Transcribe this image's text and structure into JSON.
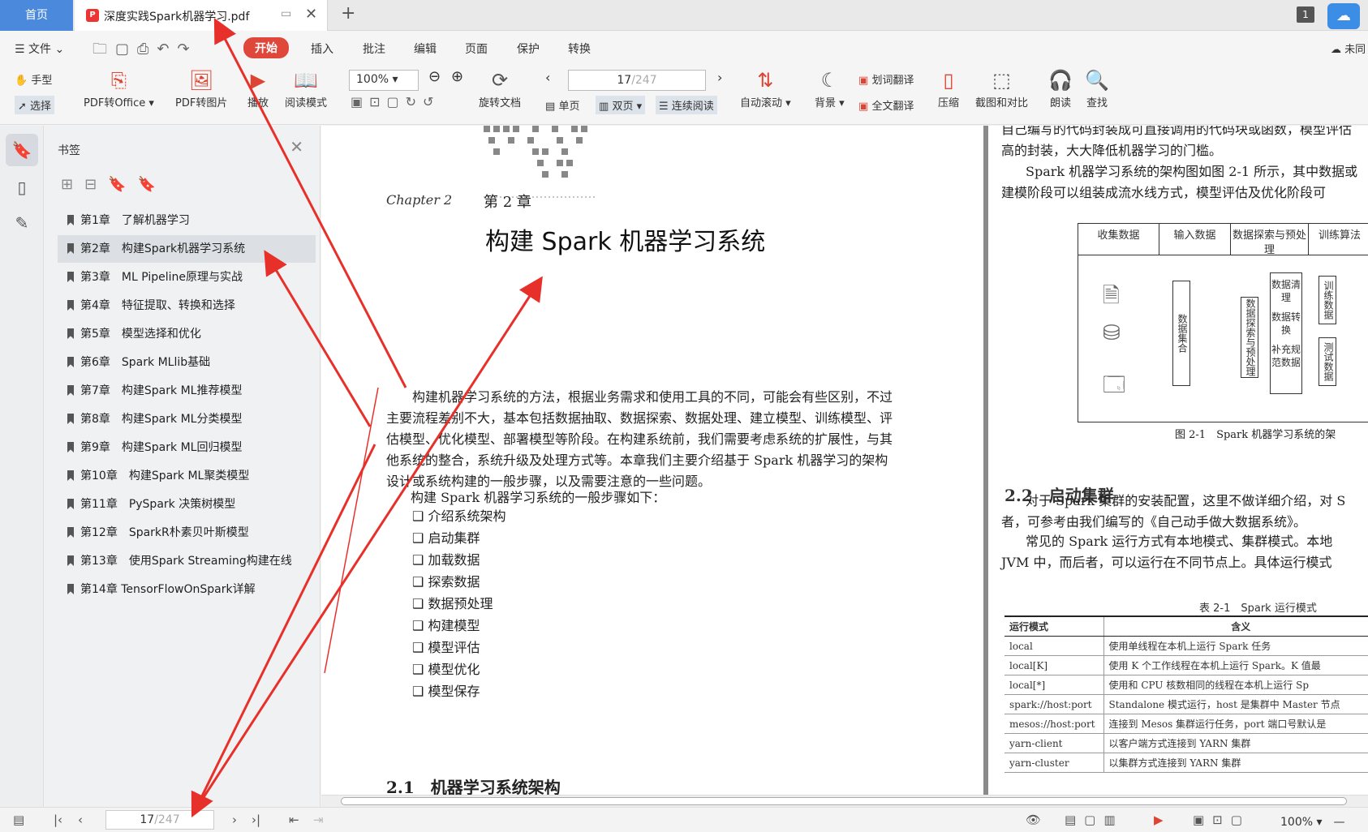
{
  "titlebar": {
    "home_tab": "首页",
    "doc_tab": "深度实践Spark机器学习.pdf",
    "badge": "1"
  },
  "menubar": {
    "file": "文件",
    "tabs": [
      "开始",
      "插入",
      "批注",
      "编辑",
      "页面",
      "保护",
      "转换"
    ],
    "active_tab": "开始",
    "cloud": "未同"
  },
  "ribbon": {
    "hand": "手型",
    "select": "选择",
    "pdf_to_office": "PDF转Office",
    "pdf_to_image": "PDF转图片",
    "play": "播放",
    "read_mode": "阅读模式",
    "zoom": "100%",
    "rotate": "旋转文档",
    "single": "单页",
    "double": "双页",
    "continuous": "连续阅读",
    "page_current": "17",
    "page_total": "/247",
    "auto_scroll": "自动滚动",
    "background": "背景",
    "word_translate": "划词翻译",
    "full_translate": "全文翻译",
    "compress": "压缩",
    "compare": "截图和对比",
    "read_aloud": "朗读",
    "search": "查找"
  },
  "panel": {
    "title": "书签",
    "bookmarks": [
      "第1章　了解机器学习",
      "第2章　构建Spark机器学习系统",
      "第3章　ML Pipeline原理与实战",
      "第4章　特征提取、转换和选择",
      "第5章　模型选择和优化",
      "第6章　Spark MLlib基础",
      "第7章　构建Spark ML推荐模型",
      "第8章　构建Spark ML分类模型",
      "第9章　构建Spark ML回归模型",
      "第10章　构建Spark ML聚类模型",
      "第11章　PySpark 决策树模型",
      "第12章　SparkR朴素贝叶斯模型",
      "第13章　使用Spark Streaming构建在线",
      "第14章 TensorFlowOnSpark详解"
    ],
    "selected_index": 1
  },
  "left_page": {
    "chapter_label": "Chapter 2",
    "chapter_no": "第 2 章",
    "chapter_title": "构建 Spark 机器学习系统",
    "paragraph": "构建机器学习系统的方法，根据业务需求和使用工具的不同，可能会有些区别，不过主要流程差别不大，基本包括数据抽取、数据探索、数据处理、建立模型、训练模型、评估模型、优化模型、部署模型等阶段。在构建系统前，我们需要考虑系统的扩展性，与其他系统的整合，系统升级及处理方式等。本章我们主要介绍基于 Spark 机器学习的架构设计或系统构建的一般步骤，以及需要注意的一些问题。",
    "steps_intro": "构建 Spark 机器学习系统的一般步骤如下：",
    "steps": [
      "介绍系统架构",
      "启动集群",
      "加载数据",
      "探索数据",
      "数据预处理",
      "构建模型",
      "模型评估",
      "模型优化",
      "模型保存"
    ],
    "section": "2.1　机器学习系统架构"
  },
  "right_page": {
    "para1": "自己编写的代码封装成可直接调用的代码块或函数，模型评估高的封装，大大降低机器学习的门槛。",
    "para2": "Spark 机器学习系统的架构图如图 2-1 所示，其中数据或建模阶段可以组装成流水线方式，模型评估及优化阶段可",
    "diagram_cols": [
      "收集数据",
      "输入数据",
      "数据探索与预处理",
      "训练算法"
    ],
    "diagram_boxes": [
      "数据集合",
      "数据探索与预处理",
      "数据清理",
      "数据转换",
      "补充规范数据",
      "训练数据",
      "测试数据"
    ],
    "caption": "图 2-1　Spark 机器学习系统的架",
    "section": "2.2　启动集群",
    "para3": "对于 Spark 集群的安装配置，这里不做详细介绍，对 S",
    "para3b": "者，可参考由我们编写的《自己动手做大数据系统》。",
    "para4": "常见的 Spark 运行方式有本地模式、集群模式。本地",
    "para4b": "JVM 中，而后者，可以运行在不同节点上。具体运行模式",
    "table_caption": "表 2-1　Spark 运行模式",
    "table_headers": [
      "运行模式",
      "含义"
    ],
    "table_rows": [
      [
        "local",
        "使用单线程在本机上运行 Spark 任务"
      ],
      [
        "local[K]",
        "使用 K 个工作线程在本机上运行 Spark。K 值最"
      ],
      [
        "local[*]",
        "使用和 CPU 核数相同的线程在本机上运行 Sp"
      ],
      [
        "spark://host:port",
        "Standalone 模式运行，host 是集群中 Master 节点"
      ],
      [
        "mesos://host:port",
        "连接到 Mesos 集群运行任务，port 端口号默认是"
      ],
      [
        "yarn-client",
        "以客户端方式连接到 YARN 集群"
      ],
      [
        "yarn-cluster",
        "以集群方式连接到 YARN 集群"
      ]
    ]
  },
  "statusbar": {
    "page_current": "17",
    "page_total": "/247",
    "zoom": "100%"
  },
  "colors": {
    "accent": "#e0473b",
    "home_tab": "#4a89dc",
    "annotation_arrow": "#e8302a"
  }
}
